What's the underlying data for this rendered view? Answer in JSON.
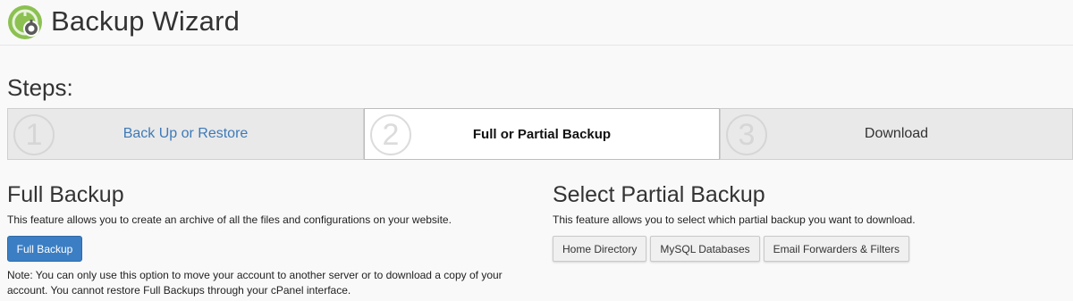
{
  "header": {
    "title": "Backup Wizard",
    "logo_icon": "backup-wizard-logo-icon"
  },
  "steps": {
    "label": "Steps:",
    "items": [
      {
        "number": "1",
        "label": "Back Up or Restore",
        "state": "link"
      },
      {
        "number": "2",
        "label": "Full or Partial Backup",
        "state": "active"
      },
      {
        "number": "3",
        "label": "Download",
        "state": "inactive"
      }
    ]
  },
  "full_backup": {
    "title": "Full Backup",
    "description": "This feature allows you to create an archive of all the files and configurations on your website.",
    "button_label": "Full Backup",
    "note": "Note: You can only use this option to move your account to another server or to download a copy of your account. You cannot restore Full Backups through your cPanel interface."
  },
  "partial_backup": {
    "title": "Select Partial Backup",
    "description": "This feature allows you to select which partial backup you want to download.",
    "buttons": [
      "Home Directory",
      "MySQL Databases",
      "Email Forwarders & Filters"
    ]
  },
  "colors": {
    "primary_button": "#3b7ec4",
    "link": "#3d7ab8",
    "logo_green": "#8cc152"
  }
}
